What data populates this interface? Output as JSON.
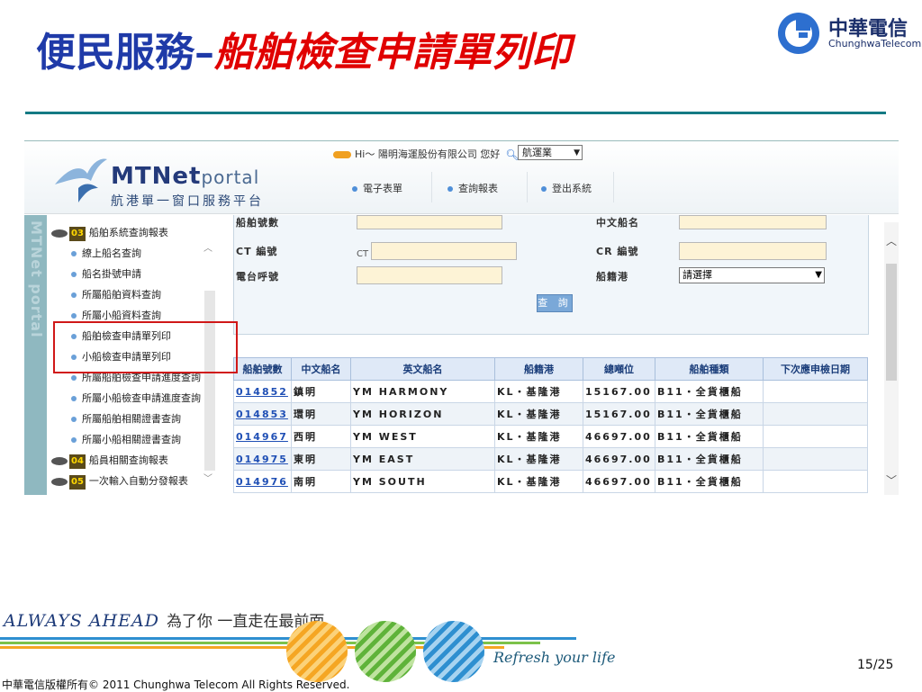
{
  "slide": {
    "title_part1": "便民服務",
    "title_sep": "–",
    "title_part2": "船舶檢查申請單列印",
    "page_number": "15/25",
    "copyright": "中華電信版權所有© 2011 Chunghwa Telecom All Rights Reserved.",
    "tagline_en": "ALWAYS AHEAD",
    "tagline_cn": "為了你 一直走在最前面",
    "refresh_text": "Refresh your life"
  },
  "logo": {
    "name_cn": "中華電信",
    "name_en": "ChunghwaTelecom"
  },
  "portal": {
    "brand": "MTNet",
    "brand_suffix": "portal",
    "brand_sub": "航港單一窗口服務平台",
    "vertical_tab": "MTNet portal",
    "greeting": "Hi～ 陽明海運股份有限公司 您好",
    "role_select": {
      "value": "航運業"
    },
    "nav": [
      "電子表單",
      "查詢報表",
      "登出系統"
    ]
  },
  "sidebar": {
    "groups": [
      {
        "num": "03",
        "label": "船舶系統查詢報表"
      },
      {
        "num": "04",
        "label": "船員相關查詢報表"
      },
      {
        "num": "05",
        "label": "一次輸入自動分發報表"
      }
    ],
    "items": [
      "繚上船名查詢",
      "船名掛號申請",
      "所屬船舶資料查詢",
      "所屬小船資料查詢",
      "船舶檢查申請單列印",
      "小船檢查申請單列印",
      "所屬船舶檢查申請進度查詢",
      "所屬小船檢查申請進度查詢",
      "所屬船舶相關證書查詢",
      "所屬小船相關證書查詢"
    ]
  },
  "form": {
    "ship_no_label": "船舶號數",
    "cn_name_label": "中文船名",
    "ct_no_label": "CT 編號",
    "ct_prefix": "CT",
    "cr_no_label": "CR 編號",
    "call_sign_label": "電台呼號",
    "port_label": "船籍港",
    "port_select": {
      "value": "請選擇"
    },
    "query_button": "查 詢"
  },
  "results": {
    "headers": [
      "船舶號數",
      "中文船名",
      "英文船名",
      "船籍港",
      "總噸位",
      "船舶種類",
      "下次應申檢日期"
    ],
    "rows": [
      [
        "014852",
        "鎮明",
        "YM HARMONY",
        "KL・基隆港",
        "15167.00",
        "B11・全貨櫃船",
        ""
      ],
      [
        "014853",
        "環明",
        "YM HORIZON",
        "KL・基隆港",
        "15167.00",
        "B11・全貨櫃船",
        ""
      ],
      [
        "014967",
        "西明",
        "YM WEST",
        "KL・基隆港",
        "46697.00",
        "B11・全貨櫃船",
        ""
      ],
      [
        "014975",
        "東明",
        "YM EAST",
        "KL・基隆港",
        "46697.00",
        "B11・全貨櫃船",
        ""
      ],
      [
        "014976",
        "南明",
        "YM SOUTH",
        "KL・基隆港",
        "46697.00",
        "B11・全貨櫃船",
        ""
      ]
    ]
  },
  "colors": {
    "title_blue": "#1f3aa8",
    "title_red": "#e00000",
    "rule_teal": "#147a84",
    "highlight_red": "#d01818",
    "link_blue": "#1f4fb5"
  },
  "icons": {
    "logo": "chunghwa-telecom-logo-icon",
    "bird": "seagull-icon",
    "search": "magnifier-icon"
  }
}
